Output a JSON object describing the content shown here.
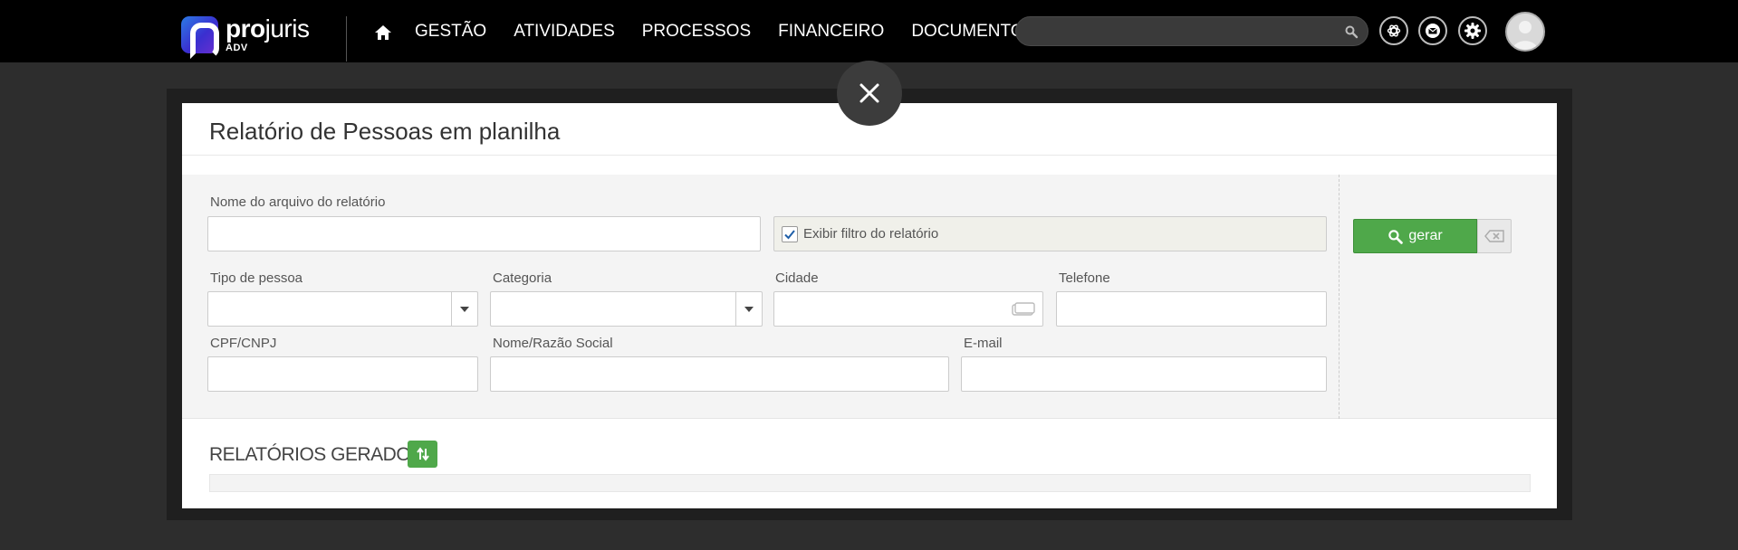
{
  "navbar": {
    "logo": {
      "word_bold": "pro",
      "word_light": "juris",
      "sub": "ADV"
    },
    "menu": [
      {
        "label": "GESTÃO"
      },
      {
        "label": "ATIVIDADES"
      },
      {
        "label": "PROCESSOS"
      },
      {
        "label": "FINANCEIRO"
      },
      {
        "label": "DOCUMENTOS"
      }
    ],
    "search": {
      "placeholder": "",
      "value": ""
    },
    "icons": [
      "home-icon",
      "search-icon",
      "openai-icon",
      "mail-icon",
      "settings-gear-icon",
      "avatar"
    ]
  },
  "modal": {
    "title": "Relatório de Pessoas em planilha",
    "fields": {
      "file_name": {
        "label": "Nome do arquivo do relatório",
        "value": ""
      },
      "show_filter": {
        "label": "Exibir filtro do relatório",
        "checked": true
      },
      "person_type": {
        "label": "Tipo de pessoa",
        "value": ""
      },
      "category": {
        "label": "Categoria",
        "value": ""
      },
      "city": {
        "label": "Cidade",
        "value": ""
      },
      "phone": {
        "label": "Telefone",
        "value": ""
      },
      "cpf_cnpj": {
        "label": "CPF/CNPJ",
        "value": ""
      },
      "name": {
        "label": "Nome/Razão Social",
        "value": ""
      },
      "email": {
        "label": "E-mail",
        "value": ""
      }
    },
    "actions": {
      "generate_label": "gerar"
    },
    "reports": {
      "title": "RELATÓRIOS GERADOS"
    }
  },
  "colors": {
    "accent_green": "#4fa84a",
    "navbar_bg": "#000000",
    "page_bg": "#2d2d2d"
  }
}
